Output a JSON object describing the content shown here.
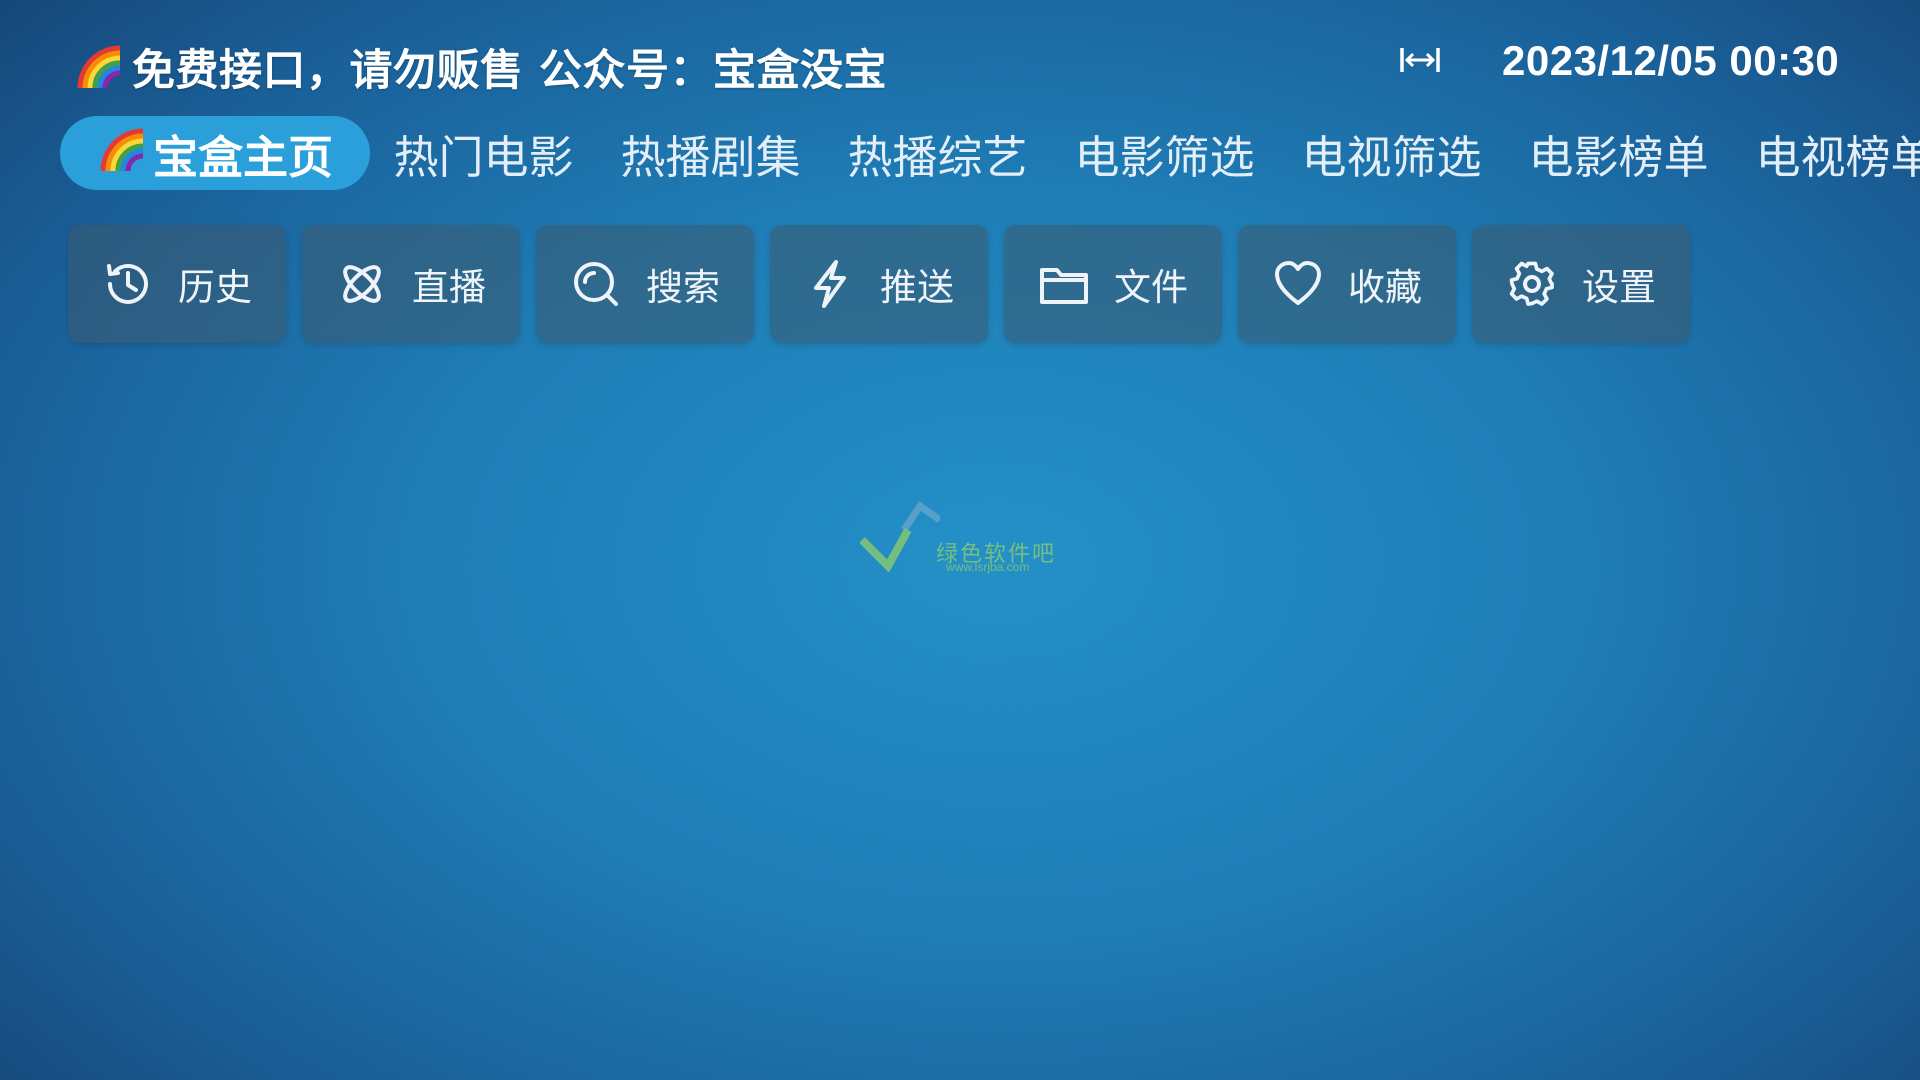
{
  "header": {
    "title": "免费接口，请勿贩售 公众号：宝盒没宝",
    "title_icon": "rainbow-icon",
    "ratio_icon": "aspect-ratio-icon",
    "clock": "2023/12/05 00:30"
  },
  "tabs": [
    {
      "label": "宝盒主页",
      "active": true,
      "icon": "rainbow-icon"
    },
    {
      "label": "热门电影",
      "active": false
    },
    {
      "label": "热播剧集",
      "active": false
    },
    {
      "label": "热播综艺",
      "active": false
    },
    {
      "label": "电影筛选",
      "active": false
    },
    {
      "label": "电视筛选",
      "active": false
    },
    {
      "label": "电影榜单",
      "active": false
    },
    {
      "label": "电视榜单",
      "active": false
    }
  ],
  "quick_actions": [
    {
      "label": "历史",
      "icon": "history-icon"
    },
    {
      "label": "直播",
      "icon": "live-icon"
    },
    {
      "label": "搜索",
      "icon": "search-icon"
    },
    {
      "label": "推送",
      "icon": "push-icon"
    },
    {
      "label": "文件",
      "icon": "folder-icon"
    },
    {
      "label": "收藏",
      "icon": "heart-icon"
    },
    {
      "label": "设置",
      "icon": "settings-icon"
    }
  ],
  "watermark": {
    "name": "绿色软件吧",
    "url": "www.lsrjba.com"
  },
  "colors": {
    "background_center": "#2490c8",
    "background_edge": "#153f6e",
    "active_tab": "#2a9fd9",
    "button_bg": "rgba(60,90,110,0.55)",
    "watermark": "#8fd06a"
  }
}
